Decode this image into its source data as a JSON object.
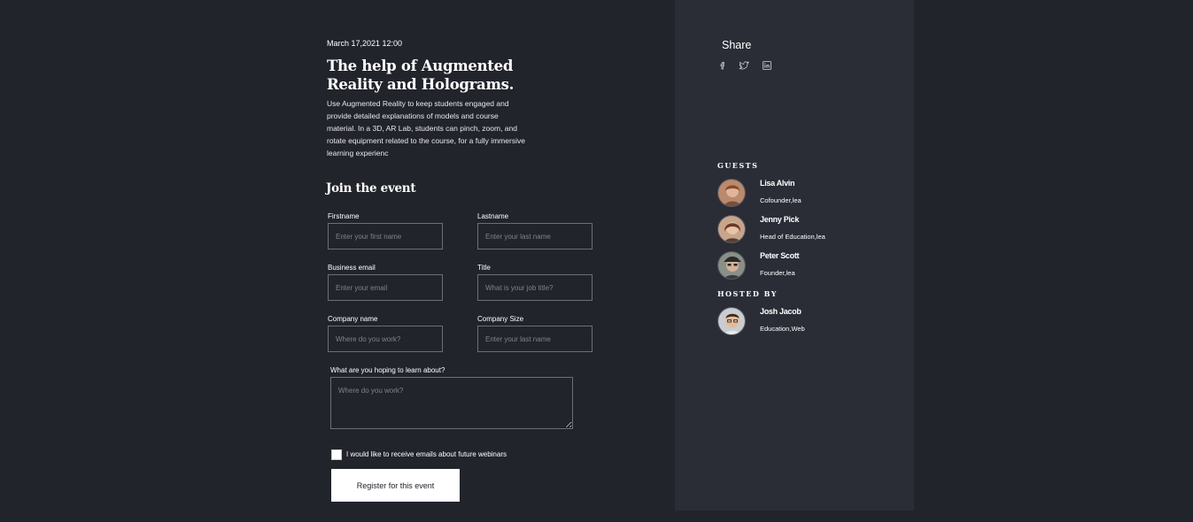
{
  "event": {
    "date": "March 17,2021 12:00",
    "title": "The help of Augmented Reality and Holograms.",
    "description": "Use Augmented Reality to keep students engaged and provide detailed explanations of models and course material. In a 3D, AR Lab, students can pinch, zoom, and rotate equipment related to the course, for a fully immersive learning experienc"
  },
  "form": {
    "heading": "Join the event",
    "firstname": {
      "label": "Firstname",
      "placeholder": "Enter your first name"
    },
    "lastname": {
      "label": "Lastname",
      "placeholder": "Enter your last name"
    },
    "email": {
      "label": "Business email",
      "placeholder": "Enter your email"
    },
    "job_title": {
      "label": "Title",
      "placeholder": "What is your job title?"
    },
    "company_name": {
      "label": "Company name",
      "placeholder": "Where do you work?"
    },
    "company_size": {
      "label": "Company Size",
      "placeholder": "Enter your last name"
    },
    "learn": {
      "label": "What are you hoping to learn about?",
      "placeholder": "Where do you work?"
    },
    "newsletter_label": "I would like to receive emails about future webinars",
    "submit_label": "Register for this event"
  },
  "sidebar": {
    "share_label": "Share",
    "share_icons": [
      "facebook-icon",
      "twitter-icon",
      "linkedin-icon"
    ],
    "guests_heading": "GUESTS",
    "guests": [
      {
        "name": "Lisa Alvin",
        "role": "Cofounder,lea"
      },
      {
        "name": "Jenny Pick",
        "role": "Head of Education,lea"
      },
      {
        "name": "Peter Scott",
        "role": "Founder,lea"
      }
    ],
    "hosted_heading": "HOSTED BY",
    "host": {
      "name": "Josh Jacob",
      "role": "Education,Web"
    }
  },
  "colors": {
    "background": "#22242c",
    "panel": "#2a2c36",
    "button": "#ffffff"
  }
}
